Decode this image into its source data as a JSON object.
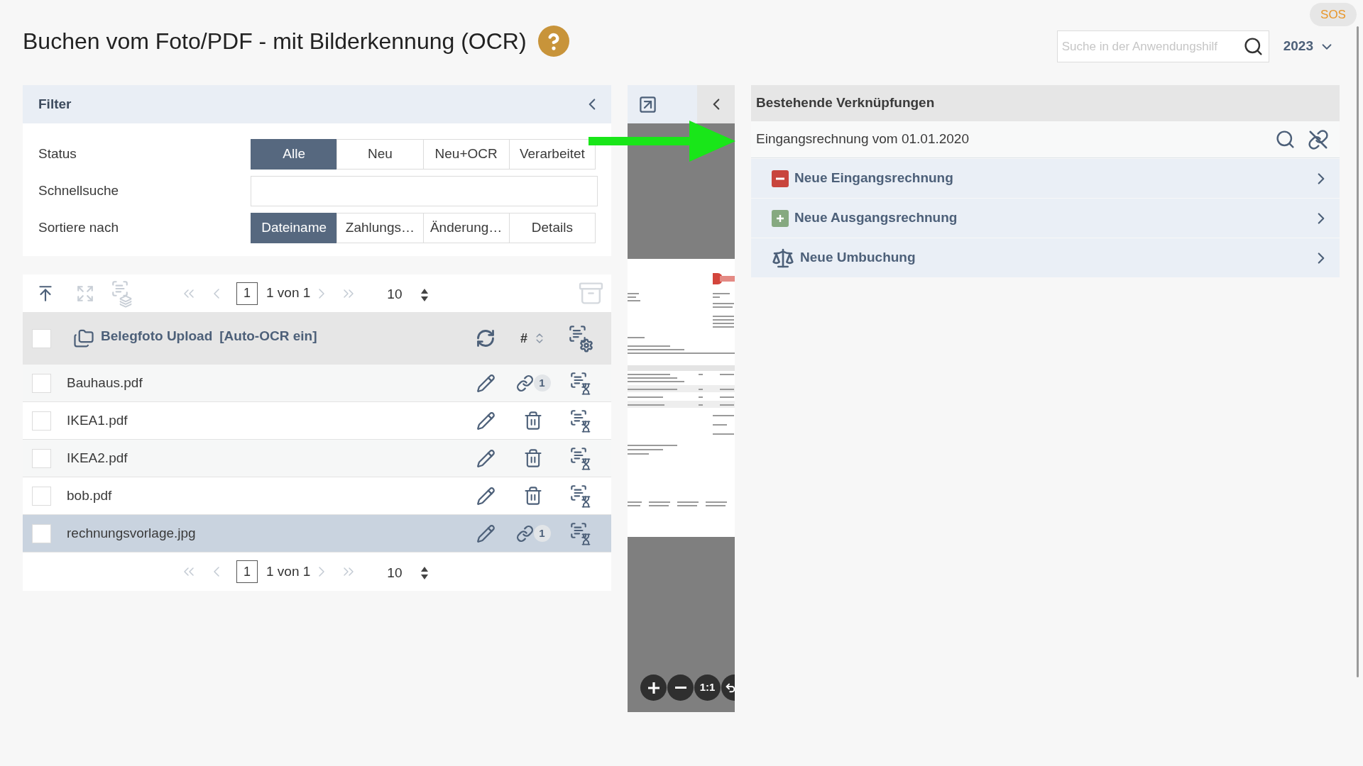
{
  "page": {
    "title": "Buchen vom Foto/PDF - mit Bilderkennung (OCR)"
  },
  "topbar": {
    "sos": "SOS",
    "search": {
      "placeholder": "Suche in der Anwendungshilf"
    },
    "year": "2023"
  },
  "filter": {
    "title": "Filter",
    "rows": [
      {
        "kind": "segments",
        "label": "Status",
        "options": [
          {
            "label": "Alle",
            "selected": true
          },
          {
            "label": "Neu",
            "selected": false
          },
          {
            "label": "Neu+OCR",
            "selected": false
          },
          {
            "label": "Verarbeitet",
            "selected": false
          }
        ]
      },
      {
        "kind": "input",
        "label": "Schnellsuche"
      },
      {
        "kind": "segments",
        "label": "Sortiere nach",
        "options": [
          {
            "label": "Dateiname",
            "selected": true
          },
          {
            "label": "Zahlungs…",
            "selected": false
          },
          {
            "label": "Änderung…",
            "selected": false
          },
          {
            "label": "Details",
            "selected": false
          }
        ]
      }
    ]
  },
  "list": {
    "tools": [
      {
        "kind": "to-top",
        "disabled": false
      },
      {
        "kind": "expand",
        "disabled": true
      },
      {
        "kind": "ocr-stack",
        "disabled": true
      }
    ],
    "pager_top": {
      "page": "1",
      "summary": "1 von 1",
      "per_page": "10",
      "arrows_disabled": true
    },
    "archive": {
      "disabled": true
    },
    "folder": {
      "checked": false,
      "title": "Belegfoto Upload",
      "tag": "[Auto-OCR ein]",
      "count_label": "#"
    },
    "files": [
      {
        "name": "Bauhaus.pdf",
        "checked": false,
        "selected": false,
        "kind": "linked",
        "links": "1"
      },
      {
        "name": "IKEA1.pdf",
        "checked": false,
        "selected": false,
        "kind": "deletable"
      },
      {
        "name": "IKEA2.pdf",
        "checked": false,
        "selected": false,
        "kind": "deletable"
      },
      {
        "name": "bob.pdf",
        "checked": false,
        "selected": false,
        "kind": "deletable"
      },
      {
        "name": "rechnungsvorlage.jpg",
        "checked": false,
        "selected": true,
        "kind": "linked",
        "links": "1"
      }
    ],
    "pager_bottom": {
      "page": "1",
      "summary": "1 von 1",
      "per_page": "10",
      "arrows_disabled": true
    }
  },
  "preview": {
    "controls": [
      {
        "kind": "zoom-in"
      },
      {
        "kind": "zoom-out"
      },
      {
        "kind": "reset",
        "label": "1:1"
      },
      {
        "kind": "rotate"
      }
    ]
  },
  "links": {
    "title": "Bestehende Verknüpfungen",
    "entry": "Eingangsrechnung vom 01.01.2020",
    "actions": [
      {
        "kind": "expense",
        "label": "Neue Eingangsrechnung"
      },
      {
        "kind": "income",
        "label": "Neue Ausgangsrechnung"
      },
      {
        "kind": "transfer",
        "label": "Neue Umbuchung"
      }
    ]
  }
}
